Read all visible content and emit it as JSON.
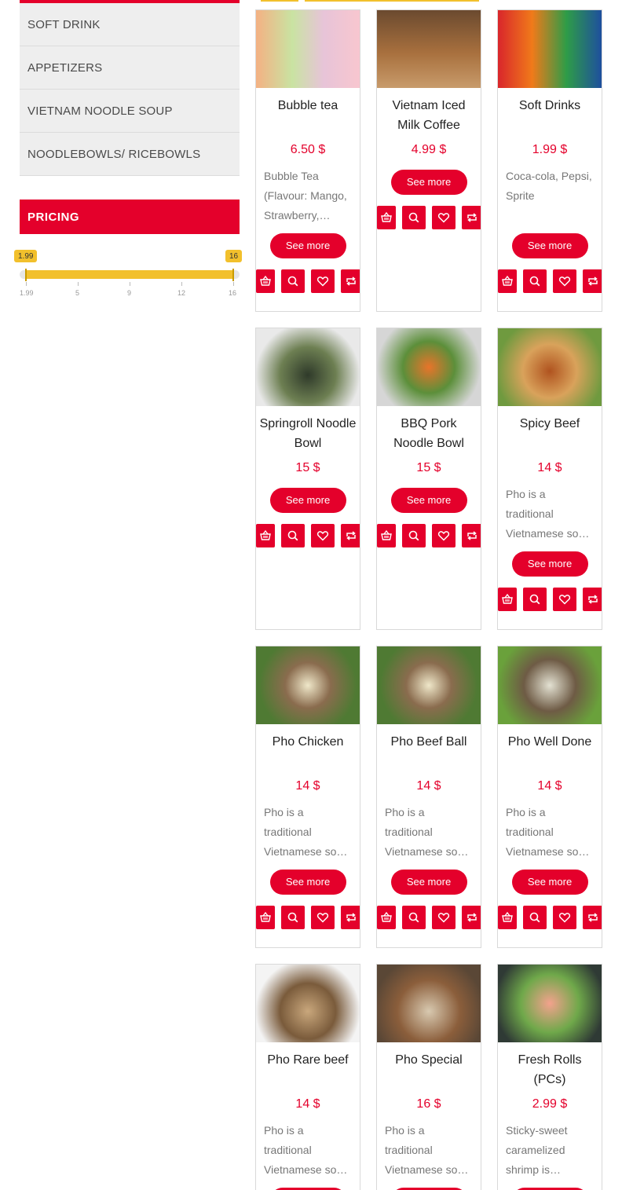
{
  "sidebar": {
    "categories": [
      {
        "label": "SOFT DRINK"
      },
      {
        "label": "APPETIZERS"
      },
      {
        "label": "VIETNAM NOODLE SOUP"
      },
      {
        "label": "NOODLEBOWLS/ RICEBOWLS"
      }
    ],
    "pricing_title": "PRICING",
    "price_min": "1.99",
    "price_max": "16",
    "ticks": [
      "1.99",
      "5",
      "9",
      "12",
      "16"
    ]
  },
  "product_button_label": "See more",
  "products": [
    {
      "name": "Bubble tea",
      "price": "6.50 $",
      "desc": "Bubble Tea (Flavour: Mango, Strawberry,…"
    },
    {
      "name": "Vietnam Iced Milk Coffee",
      "price": "4.99 $",
      "desc": ""
    },
    {
      "name": "Soft Drinks",
      "price": "1.99 $",
      "desc": "Coca-cola, Pepsi, Sprite"
    },
    {
      "name": "Springroll Noodle Bowl",
      "price": "15 $",
      "desc": ""
    },
    {
      "name": "BBQ Pork Noodle Bowl",
      "price": "15 $",
      "desc": ""
    },
    {
      "name": "Spicy Beef",
      "price": "14 $",
      "desc": "Pho is a traditional Vietnamese so…"
    },
    {
      "name": "Pho Chicken",
      "price": "14 $",
      "desc": "Pho is a traditional Vietnamese so…"
    },
    {
      "name": "Pho Beef Ball",
      "price": "14 $",
      "desc": "Pho is a traditional Vietnamese so…"
    },
    {
      "name": "Pho Well Done",
      "price": "14 $",
      "desc": "Pho is a traditional Vietnamese so…"
    },
    {
      "name": "Pho Rare beef",
      "price": "14 $",
      "desc": "Pho is a traditional Vietnamese so…"
    },
    {
      "name": "Pho Special",
      "price": "16 $",
      "desc": "Pho is a traditional Vietnamese so…"
    },
    {
      "name": "Fresh Rolls (PCs)",
      "price": "2.99 $",
      "desc": "Sticky-sweet caramelized shrimp is…"
    }
  ],
  "colors": {
    "accent": "#e4002b",
    "slider": "#f2c02c"
  }
}
